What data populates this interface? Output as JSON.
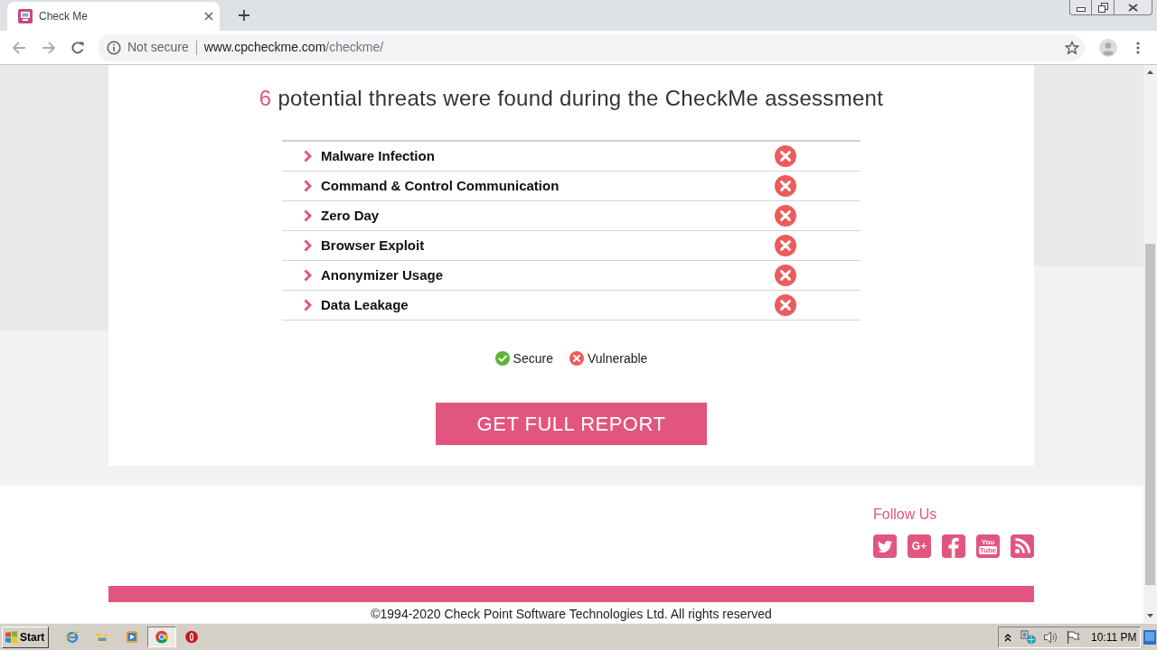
{
  "browser": {
    "tabs": [
      {
        "title": "Check Me",
        "selected": true
      }
    ],
    "address_bar": {
      "security_label": "Not secure",
      "host": "www.cpcheckme.com",
      "path": "/checkme/"
    }
  },
  "page": {
    "heading": {
      "count": "6",
      "text": "potential threats were found during the CheckMe assessment"
    },
    "threats": [
      {
        "label": "Malware Infection",
        "vulnerable": true
      },
      {
        "label": "Command & Control Communication",
        "vulnerable": true
      },
      {
        "label": "Zero Day",
        "vulnerable": true
      },
      {
        "label": "Browser Exploit",
        "vulnerable": true
      },
      {
        "label": "Anonymizer Usage",
        "vulnerable": true
      },
      {
        "label": "Data Leakage",
        "vulnerable": true
      }
    ],
    "legend": [
      {
        "kind": "secure",
        "label": "Secure"
      },
      {
        "kind": "vulnerable",
        "label": "Vulnerable"
      }
    ],
    "report_button": "GET FULL REPORT",
    "footer": {
      "follow_us": "Follow Us",
      "social": [
        {
          "kind": "twitter"
        },
        {
          "kind": "google_plus",
          "label": "G+"
        },
        {
          "kind": "facebook"
        },
        {
          "kind": "youtube",
          "label_lines": [
            "You",
            "Tube"
          ]
        },
        {
          "kind": "rss"
        }
      ],
      "copyright": "©1994-2020 Check Point Software Technologies Ltd. All rights reserved"
    }
  },
  "taskbar": {
    "start": "Start",
    "programs": [
      {
        "kind": "ie",
        "selected": false
      },
      {
        "kind": "folder",
        "selected": false
      },
      {
        "kind": "media",
        "selected": false
      },
      {
        "kind": "chrome",
        "selected": true
      },
      {
        "kind": "stop",
        "selected": false
      }
    ],
    "clock": "10:11 PM"
  }
}
